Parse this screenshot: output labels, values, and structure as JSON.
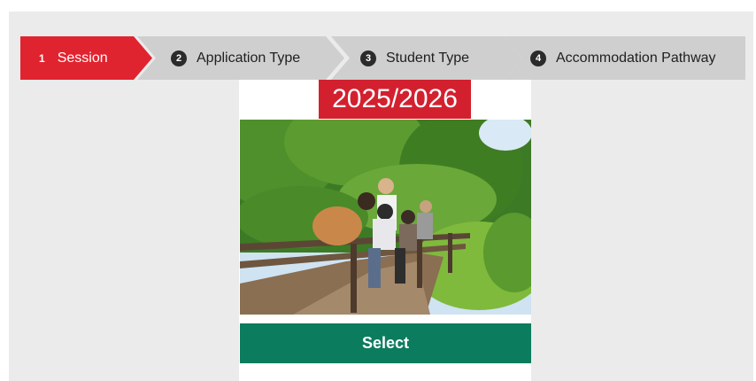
{
  "steps": [
    {
      "number": "1",
      "label": "Session",
      "active": true
    },
    {
      "number": "2",
      "label": "Application Type",
      "active": false
    },
    {
      "number": "3",
      "label": "Student Type",
      "active": false
    },
    {
      "number": "4",
      "label": "Accommodation Pathway",
      "active": false
    }
  ],
  "session_card": {
    "year": "2025/2026",
    "select_label": "Select"
  },
  "colors": {
    "active_step": "#e0242f",
    "inactive_step": "#cfcfcf",
    "year_badge": "#d3202f",
    "select_button": "#0c7c5e"
  }
}
